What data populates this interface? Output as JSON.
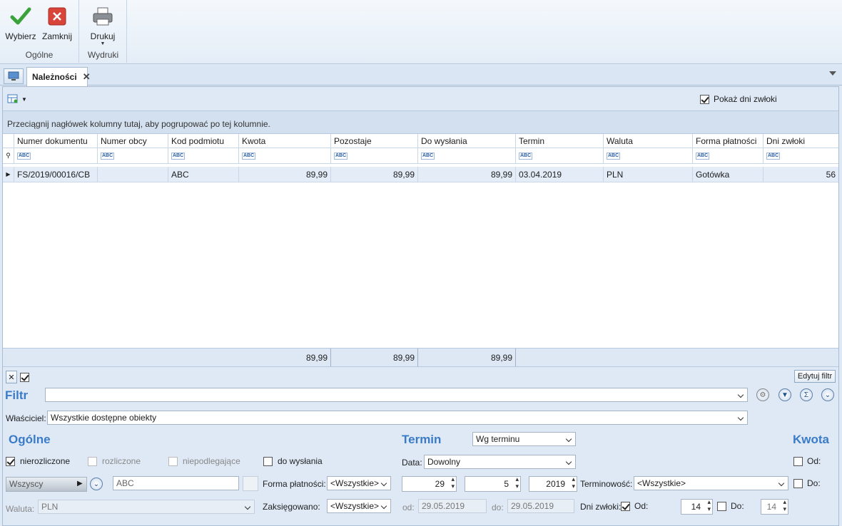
{
  "ribbon": {
    "groups": [
      {
        "name": "Ogólne",
        "buttons": [
          {
            "label": "Wybierz",
            "icon": "checkmark-icon"
          },
          {
            "label": "Zamknij",
            "icon": "close-icon"
          }
        ]
      },
      {
        "name": "Wydruki",
        "buttons": [
          {
            "label": "Drukuj",
            "icon": "printer-icon"
          }
        ]
      }
    ]
  },
  "tabs": {
    "active": "Należności"
  },
  "toolbar": {
    "show_delay_label": "Pokaż dni zwłoki",
    "show_delay_checked": true
  },
  "group_hint": "Przeciągnij nagłówek kolumny tutaj, aby pogrupować po tej kolumnie.",
  "grid": {
    "columns": [
      "Numer dokumentu",
      "Numer obcy",
      "Kod podmiotu",
      "Kwota",
      "Pozostaje",
      "Do wysłania",
      "Termin",
      "Waluta",
      "Forma płatności",
      "Dni zwłoki"
    ],
    "rows": [
      [
        "FS/2019/00016/CB",
        "",
        "ABC",
        "89,99",
        "89,99",
        "89,99",
        "03.04.2019",
        "PLN",
        "Gotówka",
        "56"
      ]
    ],
    "totals": {
      "kwota": "89,99",
      "pozostaje": "89,99",
      "do_wyslania": "89,99"
    }
  },
  "edit_filter_button": "Edytuj filtr",
  "filter": {
    "label": "Filtr",
    "value": "",
    "owner_label": "Właściciel:",
    "owner_value": "Wszystkie dostępne obiekty"
  },
  "general": {
    "title": "Ogólne",
    "nierozliczone": "nierozliczone",
    "rozliczone": "rozliczone",
    "niepodlegajace": "niepodlegające",
    "do_wyslania": "do wysłania",
    "who_value": "Wszyscy",
    "code_value": "ABC",
    "waluta_label": "Waluta:",
    "waluta_value": "PLN",
    "forma_label": "Forma płatności:",
    "forma_value": "<Wszystkie>",
    "zaksiegowano_label": "Zaksięgowano:",
    "zaksiegowano_value": "<Wszystkie>"
  },
  "termin": {
    "title": "Termin",
    "mode": "Wg terminu",
    "data_label": "Data:",
    "data_value": "Dowolny",
    "day": "29",
    "month": "5",
    "year": "2019",
    "terminowosc_label": "Terminowość:",
    "terminowosc_value": "<Wszystkie>",
    "od_label": "od:",
    "od_value": "29.05.2019",
    "do_label": "do:",
    "do_value": "29.05.2019",
    "dni_zwloki_label": "Dni zwłoki:",
    "dni_od_label": "Od:",
    "dni_od_value": "14",
    "dni_do_label": "Do:",
    "dni_do_value": "14"
  },
  "kwota": {
    "title": "Kwota",
    "od_label": "Od:",
    "do_label": "Do:"
  }
}
